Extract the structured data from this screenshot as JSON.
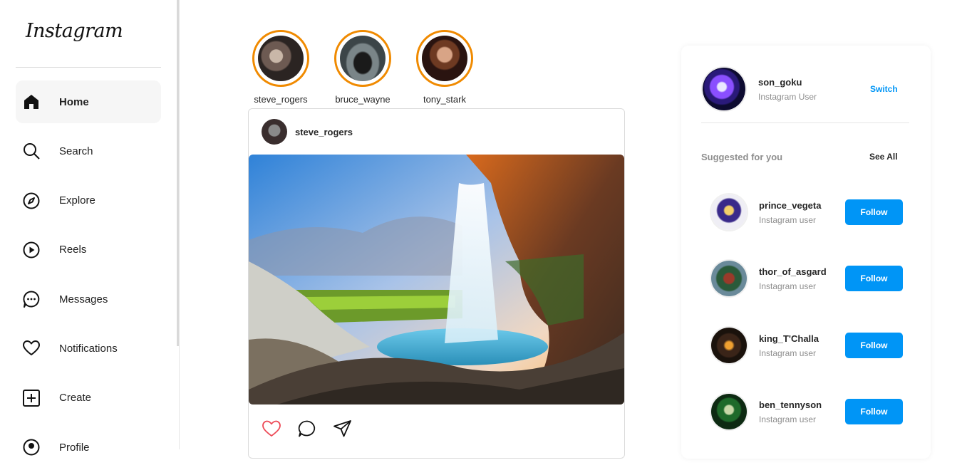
{
  "app": {
    "logo": "Instagram"
  },
  "nav": {
    "items": [
      {
        "label": "Home",
        "icon": "home-icon",
        "active": true
      },
      {
        "label": "Search",
        "icon": "search-icon"
      },
      {
        "label": "Explore",
        "icon": "compass-icon"
      },
      {
        "label": "Reels",
        "icon": "reels-icon"
      },
      {
        "label": "Messages",
        "icon": "messages-icon"
      },
      {
        "label": "Notifications",
        "icon": "heart-icon"
      },
      {
        "label": "Create",
        "icon": "plus-square-icon"
      },
      {
        "label": "Profile",
        "icon": "profile-icon"
      }
    ]
  },
  "stories": [
    {
      "username": "steve_rogers"
    },
    {
      "username": "bruce_wayne"
    },
    {
      "username": "tony_stark"
    }
  ],
  "post": {
    "username": "steve_rogers",
    "actions": [
      "like-icon",
      "comment-icon",
      "share-icon"
    ]
  },
  "sidebar_right": {
    "current_user": {
      "username": "son_goku",
      "subtitle": "Instagram User",
      "switch_label": "Switch"
    },
    "suggested_title": "Suggested for you",
    "see_all_label": "See All",
    "suggestions": [
      {
        "username": "prince_vegeta",
        "subtitle": "Instagram user",
        "button": "Follow"
      },
      {
        "username": "thor_of_asgard",
        "subtitle": "Instagram user",
        "button": "Follow"
      },
      {
        "username": "king_T'Challa",
        "subtitle": "Instagram user",
        "button": "Follow"
      },
      {
        "username": "ben_tennyson",
        "subtitle": "Instagram user",
        "button": "Follow"
      }
    ]
  },
  "colors": {
    "accent": "#0095f6",
    "story_ring": "#f08a00",
    "like": "#ed4956"
  }
}
